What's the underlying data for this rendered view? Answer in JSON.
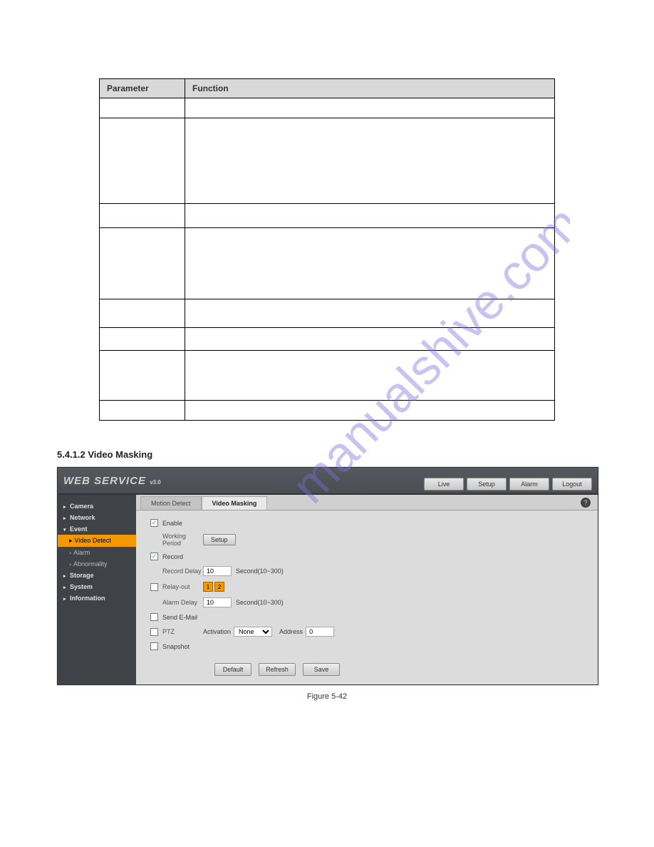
{
  "table": {
    "header_param": "Parameter",
    "header_func": "Function",
    "rows": [
      {
        "param": "",
        "func": "",
        "cls": "h36"
      },
      {
        "param": "",
        "func": "",
        "cls": "h120"
      },
      {
        "param": "",
        "func": "",
        "cls": "h40"
      },
      {
        "param": "",
        "func": "",
        "cls": "h100"
      },
      {
        "param": "",
        "func": "",
        "cls": "h44"
      },
      {
        "param": "",
        "func": "",
        "cls": "h38"
      },
      {
        "param": "",
        "func": "",
        "cls": "h76"
      },
      {
        "param": "",
        "func": "",
        "cls": "h32"
      }
    ]
  },
  "section": {
    "heading": "5.4.1.2 Video Masking",
    "desc": ""
  },
  "webservice": {
    "logo_main": "WEB  SERVICE",
    "logo_sub": "v3.0",
    "header_buttons": [
      "Live",
      "Setup",
      "Alarm",
      "Logout"
    ],
    "sidebar": {
      "items": [
        {
          "label": "Camera",
          "type": "top"
        },
        {
          "label": "Network",
          "type": "top"
        },
        {
          "label": "Event",
          "type": "top_open"
        },
        {
          "label": "Video Detect",
          "type": "active_sub"
        },
        {
          "label": "Alarm",
          "type": "sub"
        },
        {
          "label": "Abnormality",
          "type": "sub"
        },
        {
          "label": "Storage",
          "type": "top"
        },
        {
          "label": "System",
          "type": "top"
        },
        {
          "label": "Information",
          "type": "top"
        }
      ]
    },
    "tabs": {
      "motion": "Motion Detect",
      "masking": "Video Masking"
    },
    "form": {
      "enable": {
        "checked": true,
        "label": "Enable"
      },
      "working_period": {
        "label": "Working Period",
        "button": "Setup"
      },
      "record": {
        "checked": true,
        "label": "Record"
      },
      "record_delay": {
        "label": "Record Delay",
        "value": "10",
        "unit": "Second(10~300)"
      },
      "relay_out": {
        "checked": false,
        "label": "Relay-out",
        "nums": [
          "1",
          "2"
        ]
      },
      "alarm_delay": {
        "label": "Alarm Delay",
        "value": "10",
        "unit": "Second(10~300)"
      },
      "send_email": {
        "checked": false,
        "label": "Send E-Mail"
      },
      "ptz": {
        "checked": false,
        "label": "PTZ",
        "activation": "Activation",
        "option": "None",
        "address_label": "Address",
        "address_value": "0"
      },
      "snapshot": {
        "checked": false,
        "label": "Snapshot"
      },
      "footer": {
        "default": "Default",
        "refresh": "Refresh",
        "save": "Save"
      }
    },
    "help_icon": "?"
  },
  "figure_caption": "Figure 5-42",
  "watermark_text": "manualshive.com"
}
